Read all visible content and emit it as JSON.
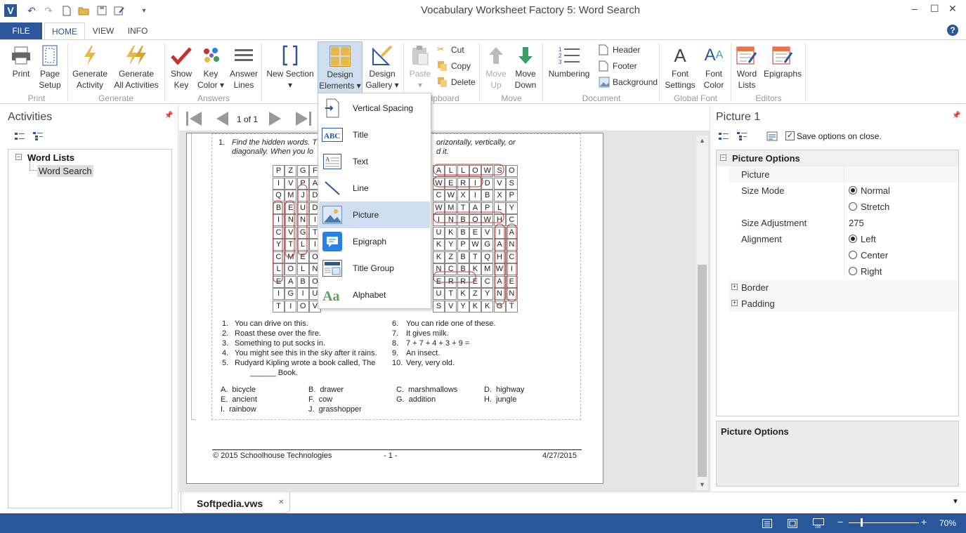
{
  "window": {
    "title": "Vocabulary Worksheet Factory 5: Word Search",
    "controls": [
      "–",
      "☐",
      "✕"
    ]
  },
  "tabs": [
    {
      "label": "FILE"
    },
    {
      "label": "HOME"
    },
    {
      "label": "VIEW"
    },
    {
      "label": "INFO"
    }
  ],
  "ribbon": {
    "print": "Print",
    "page_setup": [
      "Page",
      "Setup"
    ],
    "group_print": "Print",
    "gen_activity": [
      "Generate",
      "Activity"
    ],
    "gen_all": [
      "Generate",
      "All Activities"
    ],
    "group_generate": "Generate",
    "show_key": [
      "Show",
      "Key"
    ],
    "key_color": [
      "Key",
      "Color ▾"
    ],
    "answer_lines": [
      "Answer",
      "Lines"
    ],
    "group_answers": "Answers",
    "new_section": [
      "New Section",
      "▾"
    ],
    "design_elements": [
      "Design",
      "Elements ▾"
    ],
    "design_gallery": [
      "Design",
      "Gallery ▾"
    ],
    "paste": [
      "Paste",
      "▾"
    ],
    "cut": "Cut",
    "copy": "Copy",
    "delete": "Delete",
    "group_clipboard": "Clipboard",
    "move_up": [
      "Move",
      "Up"
    ],
    "move_down": [
      "Move",
      "Down"
    ],
    "group_move": "Move",
    "numbering": "Numbering",
    "header": "Header",
    "footer": "Footer",
    "background": "Background",
    "group_document": "Document",
    "font_settings": [
      "Font",
      "Settings"
    ],
    "font_color": [
      "Font",
      "Color"
    ],
    "group_font": "Global Font",
    "word_lists": [
      "Word",
      "Lists"
    ],
    "epigraphs": "Epigraphs",
    "group_editors": "Editors"
  },
  "dropdown": {
    "items": [
      {
        "label": "Vertical Spacing",
        "icon": "vertical-spacing-icon"
      },
      {
        "label": "Title",
        "icon": "title-abc-icon"
      },
      {
        "label": "Text",
        "icon": "text-icon"
      },
      {
        "label": "Line",
        "icon": "line-icon"
      },
      {
        "label": "Picture",
        "icon": "picture-icon"
      },
      {
        "label": "Epigraph",
        "icon": "epigraph-icon"
      },
      {
        "label": "Title Group",
        "icon": "title-group-icon"
      },
      {
        "label": "Alphabet",
        "icon": "alphabet-icon"
      }
    ],
    "selected": "Picture"
  },
  "activities": {
    "title": "Activities",
    "tree": {
      "root": "Word Lists",
      "child": "Word Search"
    }
  },
  "navigator": {
    "page": "1 of 1"
  },
  "worksheet": {
    "instruction_num": "1.",
    "instruction_a": "Find the hidden words. T",
    "instruction_a2": "orizontally, vertically, or",
    "instruction_b": "diagonally. When you lo",
    "instruction_b2": "d it.",
    "grid_left": [
      [
        "P",
        "Z",
        "G",
        "F"
      ],
      [
        "I",
        "V",
        "P",
        "A"
      ],
      [
        "Q",
        "M",
        "J",
        "D"
      ],
      [
        "B",
        "E",
        "U",
        "D"
      ],
      [
        "I",
        "N",
        "N",
        "I"
      ],
      [
        "C",
        "V",
        "G",
        "T"
      ],
      [
        "Y",
        "T",
        "L",
        "I"
      ],
      [
        "C",
        "M",
        "E",
        "O"
      ],
      [
        "L",
        "O",
        "L",
        "N"
      ],
      [
        "E",
        "A",
        "B",
        "O"
      ],
      [
        "I",
        "G",
        "I",
        "U"
      ],
      [
        "T",
        "I",
        "O",
        "V"
      ]
    ],
    "grid_right": [
      [
        "A",
        "L",
        "L",
        "O",
        "W",
        "S",
        "O"
      ],
      [
        "W",
        "E",
        "R",
        "I",
        "D",
        "V",
        "S"
      ],
      [
        "C",
        "W",
        "X",
        "I",
        "B",
        "X",
        "P"
      ],
      [
        "W",
        "M",
        "T",
        "A",
        "P",
        "L",
        "Y"
      ],
      [
        "I",
        "N",
        "B",
        "O",
        "W",
        "H",
        "C"
      ],
      [
        "U",
        "K",
        "B",
        "E",
        "V",
        "I",
        "A"
      ],
      [
        "K",
        "Y",
        "P",
        "W",
        "G",
        "A",
        "N"
      ],
      [
        "K",
        "Z",
        "B",
        "T",
        "Q",
        "H",
        "C"
      ],
      [
        "N",
        "C",
        "B",
        "K",
        "M",
        "W",
        "I"
      ],
      [
        "E",
        "R",
        "R",
        "E",
        "C",
        "A",
        "E"
      ],
      [
        "U",
        "T",
        "K",
        "Z",
        "Y",
        "N",
        "N"
      ],
      [
        "S",
        "V",
        "Y",
        "K",
        "K",
        "G",
        "T"
      ]
    ],
    "clues_left": [
      {
        "n": "1.",
        "t": "You can drive on this."
      },
      {
        "n": "2.",
        "t": "Roast these over the fire."
      },
      {
        "n": "3.",
        "t": "Something to put socks in."
      },
      {
        "n": "4.",
        "t": "You might see this in the sky after it rains."
      },
      {
        "n": "5.",
        "t": "Rudyard Kipling wrote a book called, The"
      },
      {
        "n": "",
        "t": "______ Book."
      }
    ],
    "clues_right": [
      {
        "n": "6.",
        "t": "You can ride one of these."
      },
      {
        "n": "7.",
        "t": "It gives milk."
      },
      {
        "n": "8.",
        "t": "7 + 7 + 4 + 3 + 9 ="
      },
      {
        "n": "9.",
        "t": "An insect."
      },
      {
        "n": "10.",
        "t": "Very, very old."
      }
    ],
    "answers": [
      {
        "l": "A.",
        "t": "bicycle"
      },
      {
        "l": "B.",
        "t": "drawer"
      },
      {
        "l": "C.",
        "t": "marshmallows"
      },
      {
        "l": "D.",
        "t": "highway"
      },
      {
        "l": "E.",
        "t": "ancient"
      },
      {
        "l": "F.",
        "t": "cow"
      },
      {
        "l": "G.",
        "t": "addition"
      },
      {
        "l": "H.",
        "t": "jungle"
      },
      {
        "l": "I.",
        "t": "rainbow"
      },
      {
        "l": "J.",
        "t": "grasshopper"
      }
    ],
    "footer_left": "© 2015 Schoolhouse Technologies",
    "footer_mid": "- 1 -",
    "footer_right": "4/27/2015"
  },
  "doc_tab": {
    "label": "Softpedia.vws",
    "close": "✕"
  },
  "right": {
    "title": "Picture 1",
    "save_label": "Save options on close.",
    "section": "Picture Options",
    "rows": {
      "picture": "Picture",
      "size_mode": "Size Mode",
      "normal": "Normal",
      "stretch": "Stretch",
      "size_adj": "Size Adjustment",
      "size_adj_val": "275",
      "alignment": "Alignment",
      "left": "Left",
      "center": "Center",
      "right": "Right",
      "border": "Border",
      "padding": "Padding"
    },
    "help_title": "Picture Options"
  },
  "status": {
    "zoom": "70%"
  }
}
